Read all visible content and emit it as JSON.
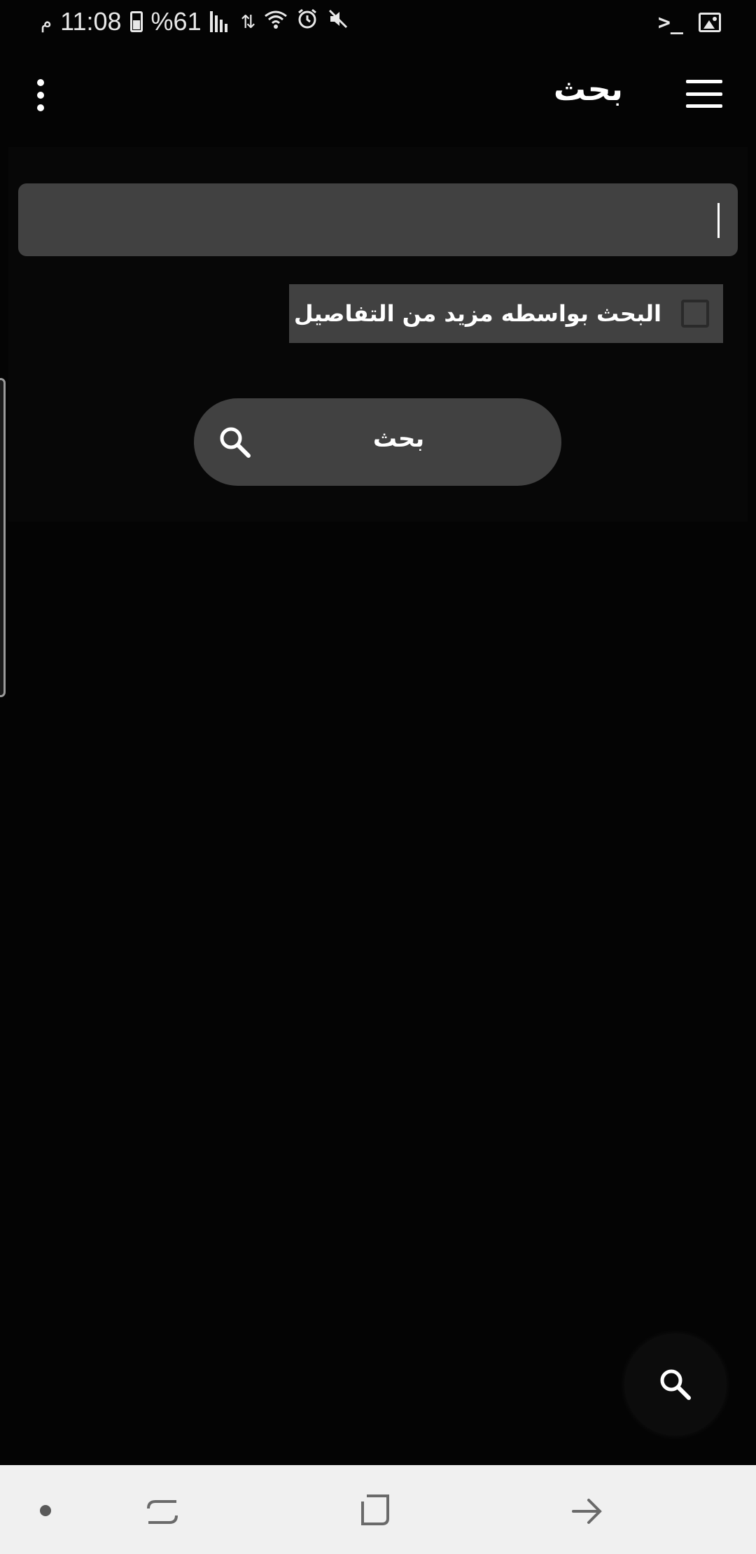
{
  "status_bar": {
    "ampm": "م",
    "time": "11:08",
    "battery": "%61"
  },
  "toolbar": {
    "title": "بحث"
  },
  "search": {
    "input_value": "",
    "detail_checkbox_label": "البحث بواسطه مزيد من التفاصيل",
    "detail_checkbox_checked": false,
    "button_label": "بحث"
  },
  "icons": {
    "menu": "hamburger-menu-icon",
    "overflow": "more-vert-icon",
    "search": "search-icon",
    "fab": "search-icon"
  },
  "colors": {
    "background": "#040404",
    "surface": "#414141",
    "text": "#ffffff",
    "nav_bar": "#f0f0f0"
  }
}
